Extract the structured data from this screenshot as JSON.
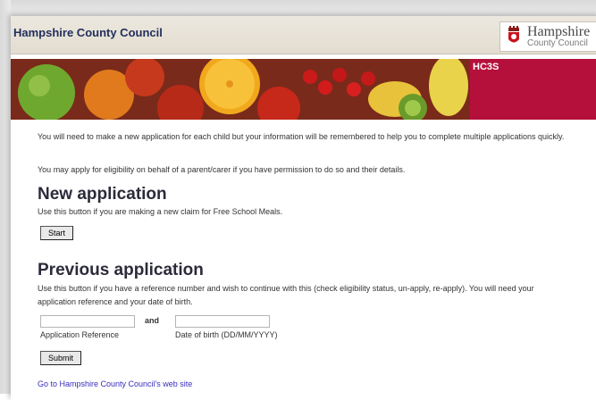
{
  "header": {
    "council_name": "Hampshire County Council",
    "logo_line1": "Hampshire",
    "logo_line2": "County Council",
    "banner_tag": "HC3S"
  },
  "intro": {
    "line1": "You will need to make a new application for each child but your information will be remembered to help you to complete multiple applications quickly.",
    "line2": "You may apply for eligibility on behalf of a parent/carer if you have permission to do so and their details."
  },
  "new_application": {
    "title": "New application",
    "description": "Use this button if you are making a new claim for Free School Meals.",
    "button": "Start"
  },
  "previous_application": {
    "title": "Previous application",
    "description": "Use this button if you have a reference number and wish to continue with this (check eligibility status, un-apply, re-apply). You will need your application reference and your date of birth.",
    "reference_label": "Application Reference",
    "and_text": "and",
    "dob_label": "Date of birth (DD/MM/YYYY)",
    "reference_value": "",
    "dob_value": "",
    "button": "Submit"
  },
  "footer": {
    "link_text": "Go to Hampshire County Council's web site"
  },
  "colors": {
    "header_text": "#222f5c",
    "accent": "#b5103c",
    "link": "#3a2dbb"
  }
}
